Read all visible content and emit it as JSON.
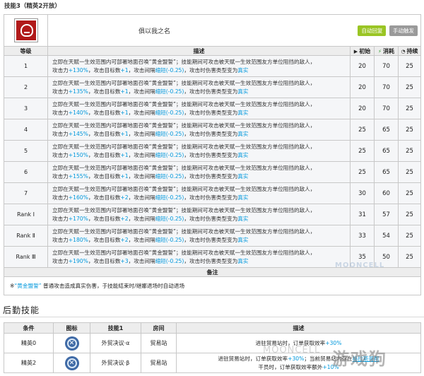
{
  "skill": {
    "title": "技能3（精英2开放）",
    "name": "俱以我之名",
    "badges": [
      "自动回复",
      "手动触发"
    ],
    "headers": {
      "level": "等级",
      "desc": "描述",
      "initial": "初始",
      "cost": "消耗",
      "duration": "持续"
    },
    "desc_prefix": "立即在天赋一生效范围内可部署地面召唤“黄金盟誓”；技能期间可攻击被天赋一生效范围友方单位阻挡的敌人，",
    "desc_atk": "攻击力",
    "desc_targets": "，攻击目标数",
    "desc_interval": "，攻击间隔",
    "desc_short": "缩短",
    "desc_suffix": "，攻击时伤害类型变为",
    "desc_true": "真实",
    "levels": [
      {
        "label": "1",
        "atk": "+130%",
        "targets": "+1",
        "interval": "(-0.25)",
        "initial": "20",
        "cost": "70",
        "duration": "25"
      },
      {
        "label": "2",
        "atk": "+135%",
        "targets": "+1",
        "interval": "(-0.25)",
        "initial": "20",
        "cost": "70",
        "duration": "25"
      },
      {
        "label": "3",
        "atk": "+140%",
        "targets": "+1",
        "interval": "(-0.25)",
        "initial": "20",
        "cost": "70",
        "duration": "25"
      },
      {
        "label": "4",
        "atk": "+145%",
        "targets": "+1",
        "interval": "(-0.25)",
        "initial": "25",
        "cost": "65",
        "duration": "25"
      },
      {
        "label": "5",
        "atk": "+150%",
        "targets": "+1",
        "interval": "(-0.25)",
        "initial": "25",
        "cost": "65",
        "duration": "25"
      },
      {
        "label": "6",
        "atk": "+155%",
        "targets": "+1",
        "interval": "(-0.25)",
        "initial": "25",
        "cost": "65",
        "duration": "25"
      },
      {
        "label": "7",
        "atk": "+160%",
        "targets": "+2",
        "interval": "(-0.25)",
        "initial": "30",
        "cost": "60",
        "duration": "25"
      },
      {
        "label": "Rank Ⅰ",
        "atk": "+170%",
        "targets": "+2",
        "interval": "(-0.25)",
        "initial": "31",
        "cost": "57",
        "duration": "25"
      },
      {
        "label": "Rank Ⅱ",
        "atk": "+180%",
        "targets": "+2",
        "interval": "(-0.25)",
        "initial": "33",
        "cost": "54",
        "duration": "25"
      },
      {
        "label": "Rank Ⅲ",
        "atk": "+190%",
        "targets": "+3",
        "interval": "(-0.25)",
        "initial": "35",
        "cost": "50",
        "duration": "25"
      }
    ],
    "notes_header": "备注",
    "note_prefix": "※",
    "note_summon": "“黄金盟誓”",
    "note_text": "普通攻击造成真实伤害，于技能结束时/继娜退场时自动退场"
  },
  "base_skills": {
    "section_title": "后勤技能",
    "headers": {
      "condition": "条件",
      "icon": "图标",
      "skill": "技能1",
      "room": "房间",
      "desc": "描述"
    },
    "rows": [
      {
        "condition": "精英0",
        "skill": "外贸决议·α",
        "room": "贸易站",
        "desc_a": "进驻贸易站时，订单获取效率",
        "desc_b": "+30%",
        "desc_c": "",
        "desc_d": "",
        "desc_e": "",
        "desc_f": ""
      },
      {
        "condition": "精英2",
        "skill": "外贸决议·β",
        "room": "贸易站",
        "desc_a": "进驻贸易站时，订单获取效率",
        "desc_b": "+30%",
        "desc_c": "；当前贸易站内存在",
        "desc_d": "格拉斯哥帮",
        "desc_e": "干员时，订单获取效率额外",
        "desc_f": "+10%"
      }
    ]
  },
  "watermarks": {
    "moon": "MOONCELL",
    "site": "游戏狗",
    "small": "MOONCELL"
  }
}
